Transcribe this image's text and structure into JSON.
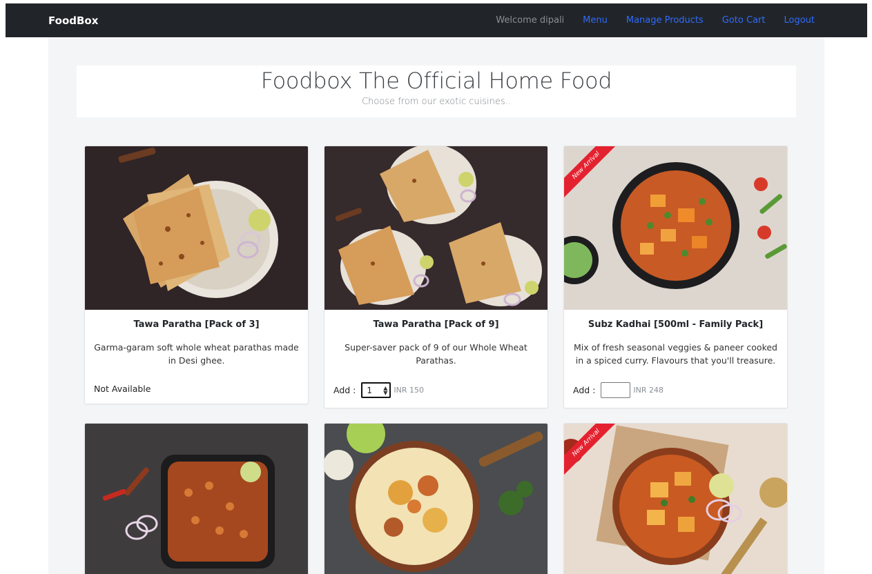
{
  "navbar": {
    "brand": "FoodBox",
    "welcome": "Welcome dipali",
    "links": [
      "Menu",
      "Manage Products",
      "Goto Cart",
      "Logout"
    ]
  },
  "jumbotron": {
    "title": "Foodbox The Official Home Food",
    "subtitle": "Choose from our exotic cuisines.."
  },
  "products": [
    {
      "name": "Tawa Paratha [Pack of 3]",
      "description": "Garma-garam soft whole wheat parathas made in Desi ghee.",
      "status": "Not Available",
      "image": "paratha-plate-image",
      "ribbon": ""
    },
    {
      "name": "Tawa Paratha [Pack of 9]",
      "description": "Super-saver pack of 9 of our Whole Wheat Parathas.",
      "add_label": "Add :",
      "quantity": "1",
      "price": "INR 150",
      "image": "paratha-three-plates-image",
      "ribbon": ""
    },
    {
      "name": "Subz Kadhai [500ml - Family Pack]",
      "description": "Mix of fresh seasonal veggies & paneer cooked in a spiced curry. Flavours that you'll treasure.",
      "add_label": "Add :",
      "quantity": "",
      "price": "INR 248",
      "image": "kadhai-bowl-image",
      "ribbon": "New Arrival"
    },
    {
      "image": "chole-pan-image",
      "ribbon": ""
    },
    {
      "image": "biryani-image",
      "ribbon": ""
    },
    {
      "image": "paneer-curry-image",
      "ribbon": "New Arrival"
    }
  ],
  "colors": {
    "navbar_bg": "#212529",
    "link": "#2f6bff",
    "ribbon": "#e4222f"
  }
}
